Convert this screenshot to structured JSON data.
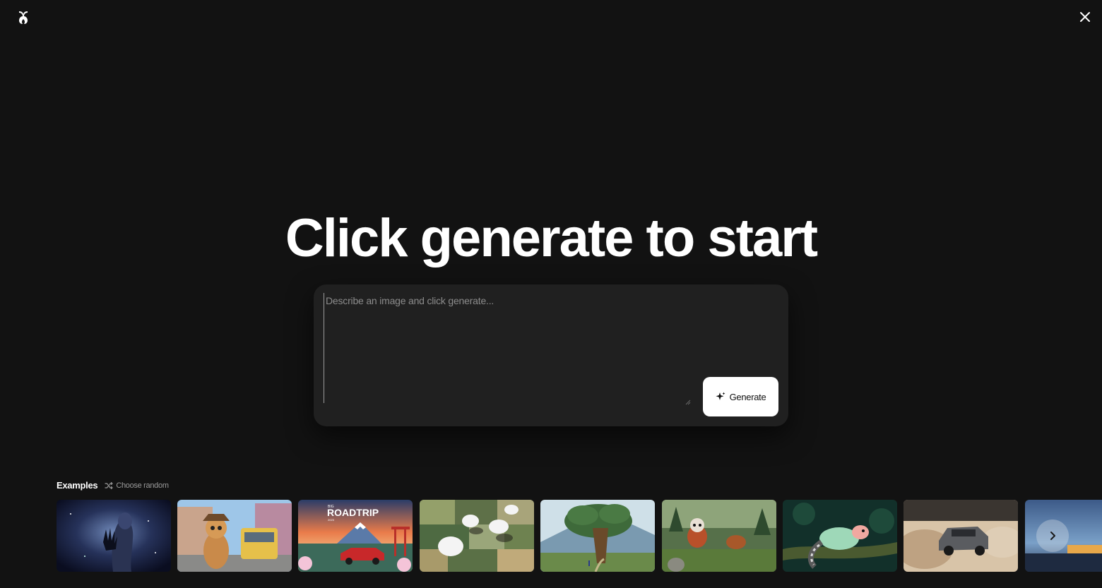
{
  "app": {
    "logo_icon": "krea-logo-icon",
    "close_icon": "close-icon"
  },
  "main": {
    "headline": "Click generate to start",
    "prompt_placeholder": "Describe an image and click generate...",
    "prompt_value": "",
    "generate_label": "Generate",
    "generate_icon": "sparkle-icon"
  },
  "examples": {
    "title": "Examples",
    "choose_random_label": "Choose random",
    "choose_random_icon": "shuffle-icon",
    "thumbnails": [
      {
        "name": "cosmic-figure-hand",
        "text": ""
      },
      {
        "name": "cartoon-cat-tram",
        "text": ""
      },
      {
        "name": "big-roadtrip-poster",
        "text": "ROADTRIP",
        "small_top": "BIG",
        "small_bottom": "2023"
      },
      {
        "name": "clouds-over-fields",
        "text": ""
      },
      {
        "name": "big-tree-landscape",
        "text": ""
      },
      {
        "name": "red-panda-forest",
        "text": ""
      },
      {
        "name": "mint-red-panda-branch",
        "text": ""
      },
      {
        "name": "rally-car-dust",
        "text": ""
      },
      {
        "name": "blue-sky-night-scene",
        "text": ""
      }
    ],
    "next_icon": "chevron-right-icon"
  }
}
